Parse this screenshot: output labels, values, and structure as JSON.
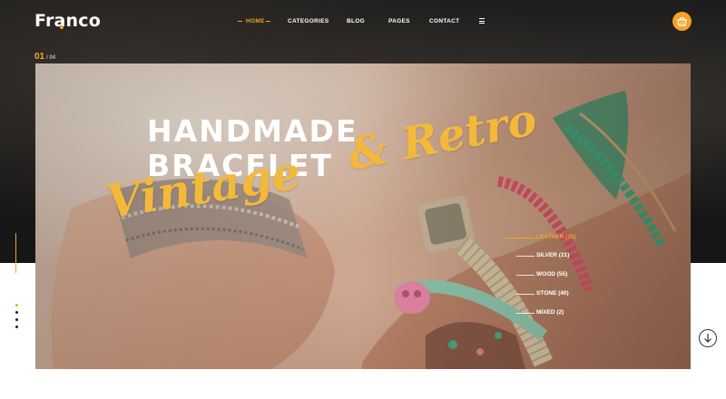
{
  "brand": {
    "name": "Franco"
  },
  "nav": {
    "items": [
      {
        "label": "HOME",
        "active": true
      },
      {
        "label": "CATEGORIES",
        "active": false
      },
      {
        "label": "BLOG",
        "active": false
      },
      {
        "label": "PAGES",
        "active": false
      },
      {
        "label": "CONTACT",
        "active": false
      }
    ],
    "menu_icon": "hamburger-icon",
    "cart_icon": "basket-icon"
  },
  "slider": {
    "current": "01",
    "total": "/ 04",
    "active_dot": 0,
    "dots_count": 4
  },
  "hero": {
    "headline_line1": "HANDMADE",
    "headline_line2": "BRACELET",
    "script_line1": "Vintage",
    "script_line2": "& Retro"
  },
  "categories": [
    {
      "label": "LEATHER (75)",
      "active": true
    },
    {
      "label": "SILVER (21)",
      "active": false
    },
    {
      "label": "WOOD (55)",
      "active": false
    },
    {
      "label": "STONE (40)",
      "active": false
    },
    {
      "label": "MIXED (2)",
      "active": false
    }
  ],
  "scroll_icon": "arrow-down-circle-icon",
  "colors": {
    "accent": "#f3a32a",
    "dark": "#161616",
    "text_light": "#ffffff"
  }
}
